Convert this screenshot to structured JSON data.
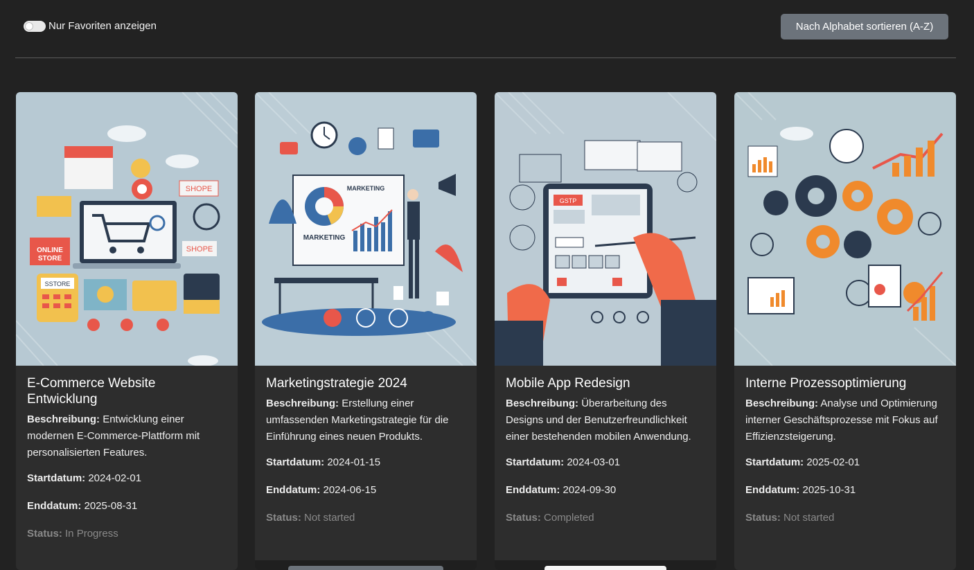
{
  "toolbar": {
    "favorites_toggle_label": "Nur Favoriten anzeigen",
    "favorites_toggle_on": false,
    "sort_button_label": "Nach Alphabet sortieren (A-Z)"
  },
  "labels": {
    "description": "Beschreibung:",
    "start": "Startdatum:",
    "end": "Enddatum:",
    "status": "Status:"
  },
  "cards": [
    {
      "title": "E-Commerce Website Entwicklung",
      "description": "Entwicklung einer modernen E-Commerce-Plattform mit personalisierten Features.",
      "start": "2024-02-01",
      "end": "2025-08-31",
      "status": "In Progress",
      "image_texts": [
        "ONLINE STORE",
        "SHOPE",
        "SHOPE",
        "SSTORE"
      ]
    },
    {
      "title": "Marketingstrategie 2024",
      "description": "Erstellung einer umfassenden Marketingstrategie für die Einführung eines neuen Produkts.",
      "start": "2024-01-15",
      "end": "2024-06-15",
      "status": "Not started",
      "image_texts": [
        "MARKETING",
        "MARKETING"
      ]
    },
    {
      "title": "Mobile App Redesign",
      "description": "Überarbeitung des Designs und der Benutzerfreundlichkeit einer bestehenden mobilen Anwendung.",
      "start": "2024-03-01",
      "end": "2024-09-30",
      "status": "Completed",
      "image_texts": [
        "GSTP"
      ]
    },
    {
      "title": "Interne Prozessoptimierung",
      "description": "Analyse und Optimierung interner Geschäftsprozesse mit Fokus auf Effizienzsteigerung.",
      "start": "2025-02-01",
      "end": "2025-10-31",
      "status": "Not started",
      "image_texts": []
    }
  ],
  "colors": {
    "background": "#222222",
    "card": "#2d2d2d",
    "sort_button": "#6c737b",
    "illustration_bg": "#b7c9d3",
    "accent_red": "#e8574a",
    "accent_orange": "#f08a2c",
    "accent_blue": "#3b6ea8",
    "accent_yellow": "#f2c14e"
  }
}
